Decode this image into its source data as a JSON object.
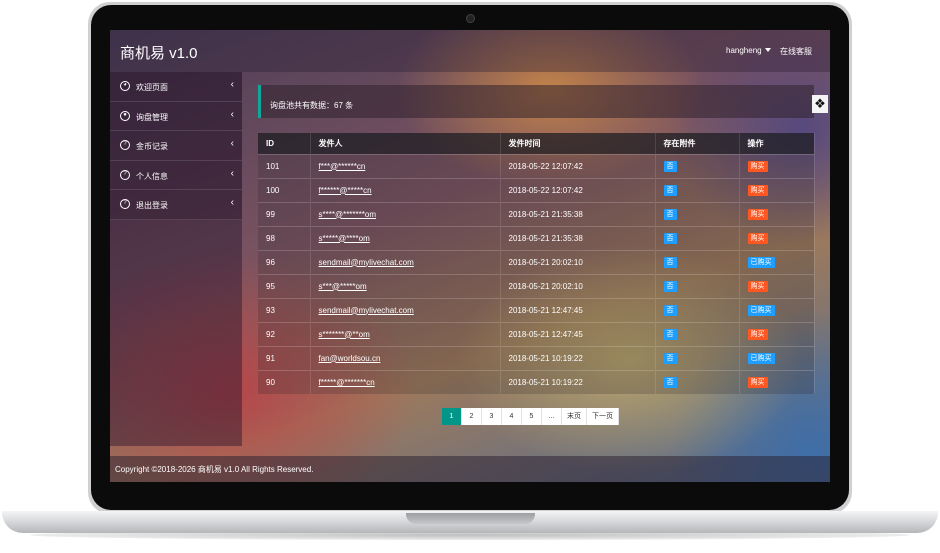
{
  "header": {
    "brand": "商机易 v1.0",
    "username": "hangheng",
    "service_label": "在线客服"
  },
  "sidebar": {
    "items": [
      {
        "label": "欢迎页面"
      },
      {
        "label": "询盘管理"
      },
      {
        "label": "金币记录"
      },
      {
        "label": "个人信息"
      },
      {
        "label": "退出登录"
      }
    ]
  },
  "info_bar": {
    "text": "询盘池共有数据：67 条"
  },
  "table": {
    "headers": [
      "ID",
      "发件人",
      "发件时间",
      "存在附件",
      "操作"
    ],
    "rows": [
      {
        "id": "101",
        "sender": "f***@******cn",
        "time": "2018-05-22 12:07:42",
        "attachment": "否",
        "action": "购买"
      },
      {
        "id": "100",
        "sender": "f******@*****cn",
        "time": "2018-05-22 12:07:42",
        "attachment": "否",
        "action": "购买"
      },
      {
        "id": "99",
        "sender": "s****@*******om",
        "time": "2018-05-21 21:35:38",
        "attachment": "否",
        "action": "购买"
      },
      {
        "id": "98",
        "sender": "s*****@****om",
        "time": "2018-05-21 21:35:38",
        "attachment": "否",
        "action": "购买"
      },
      {
        "id": "96",
        "sender": "sendmail@mylivechat.com",
        "time": "2018-05-21 20:02:10",
        "attachment": "否",
        "action": "已购买"
      },
      {
        "id": "95",
        "sender": "s***@*****om",
        "time": "2018-05-21 20:02:10",
        "attachment": "否",
        "action": "购买"
      },
      {
        "id": "93",
        "sender": "sendmail@mylivechat.com",
        "time": "2018-05-21 12:47:45",
        "attachment": "否",
        "action": "已购买"
      },
      {
        "id": "92",
        "sender": "s*******@**om",
        "time": "2018-05-21 12:47:45",
        "attachment": "否",
        "action": "购买"
      },
      {
        "id": "91",
        "sender": "fan@worldsou.cn",
        "time": "2018-05-21 10:19:22",
        "attachment": "否",
        "action": "已购买"
      },
      {
        "id": "90",
        "sender": "f*****@*******cn",
        "time": "2018-05-21 10:19:22",
        "attachment": "否",
        "action": "购买"
      }
    ]
  },
  "pagination": [
    "1",
    "2",
    "3",
    "4",
    "5",
    "...",
    "末页",
    "下一页"
  ],
  "footer": {
    "text": "Copyright ©2018-2026 商机易 v1.0 All Rights Reserved."
  },
  "colors": {
    "accent": "#009688",
    "info_border": "#0fa79a",
    "attachment_badge": "#1e9fff",
    "buy_badge": "#ff5722",
    "bought_badge": "#1e9fff"
  },
  "icons": [
    "palette-icon",
    "user-circle-icon",
    "question-circle-icon",
    "caret-down-icon",
    "chevron-left-icon",
    "menu-toggle-icon"
  ]
}
